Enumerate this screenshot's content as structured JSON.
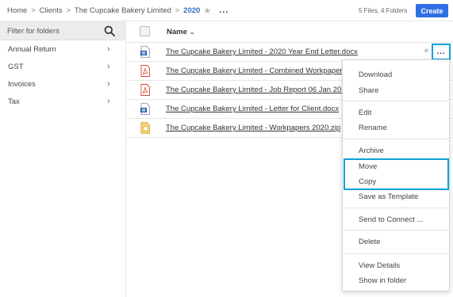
{
  "breadcrumb": {
    "items": [
      "Home",
      "Clients",
      "The Cupcake Bakery Limited"
    ],
    "separator": ">",
    "current": "2020",
    "more": "..."
  },
  "header": {
    "count": "5 Files, 4 Folders",
    "create_label": "Create"
  },
  "sidebar": {
    "filter_placeholder": "Filter for folders",
    "items": [
      {
        "label": "Annual Return"
      },
      {
        "label": "GST"
      },
      {
        "label": "Invoices"
      },
      {
        "label": "Tax"
      }
    ]
  },
  "list": {
    "name_header": "Name",
    "files": [
      {
        "name": "The Cupcake Bakery Limited - 2020 Year End Letter.docx",
        "icon": "word-doc-icon"
      },
      {
        "name": "The Cupcake Bakery Limited - Combined Workpapers 2020.pdf",
        "icon": "pdf-icon"
      },
      {
        "name": "The Cupcake Bakery Limited - Job Report 06 Jan 2020.pdf",
        "icon": "pdf-icon"
      },
      {
        "name": "The Cupcake Bakery Limited - Letter for Client.docx",
        "icon": "word-doc-icon"
      },
      {
        "name": "The Cupcake Bakery Limited - Workpapers 2020.zip",
        "icon": "zip-icon"
      }
    ],
    "row_more": "..."
  },
  "context_menu": {
    "items": [
      "Download",
      "Share",
      "Edit",
      "Rename",
      "Archive",
      "Move",
      "Copy",
      "Save as Template",
      "Send to Connect ...",
      "Delete",
      "View Details",
      "Show in folder"
    ]
  },
  "colors": {
    "accent": "#2f6fe4",
    "highlight": "#0ea2d6",
    "pdf_red": "#d9452f",
    "word_blue": "#2b5fb4",
    "zip_yellow": "#f0b429"
  }
}
